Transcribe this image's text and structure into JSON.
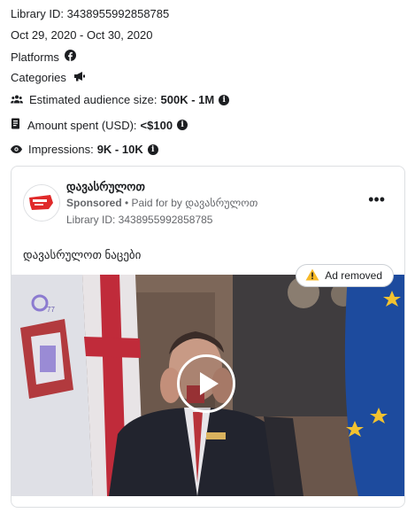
{
  "library_id_line": "Library ID: 3438955992858785",
  "date_range": "Oct 29, 2020 - Oct 30, 2020",
  "platforms_label": "Platforms",
  "platform_icons": [
    "facebook-icon"
  ],
  "categories_label": "Categories",
  "category_icons": [
    "megaphone-icon"
  ],
  "audience": {
    "label": "Estimated audience size:",
    "value": "500K - 1M"
  },
  "spent": {
    "label": "Amount spent (USD):",
    "value": "<$100"
  },
  "impressions": {
    "label": "Impressions:",
    "value": "9K - 10K"
  },
  "ad": {
    "page_name": "დავასრულოთ",
    "sponsored": "Sponsored",
    "paid_for": "• Paid for by დავასრულოთ",
    "library_id": "Library ID: 3438955992858785",
    "body_text": "დავასრულოთ ნაცები",
    "removed_badge": "Ad removed"
  },
  "colors": {
    "text": "#1c1e21",
    "secondary": "#65676b",
    "border": "#dddfe2",
    "warning": "#f7b928",
    "brand_red": "#e02a2a"
  }
}
